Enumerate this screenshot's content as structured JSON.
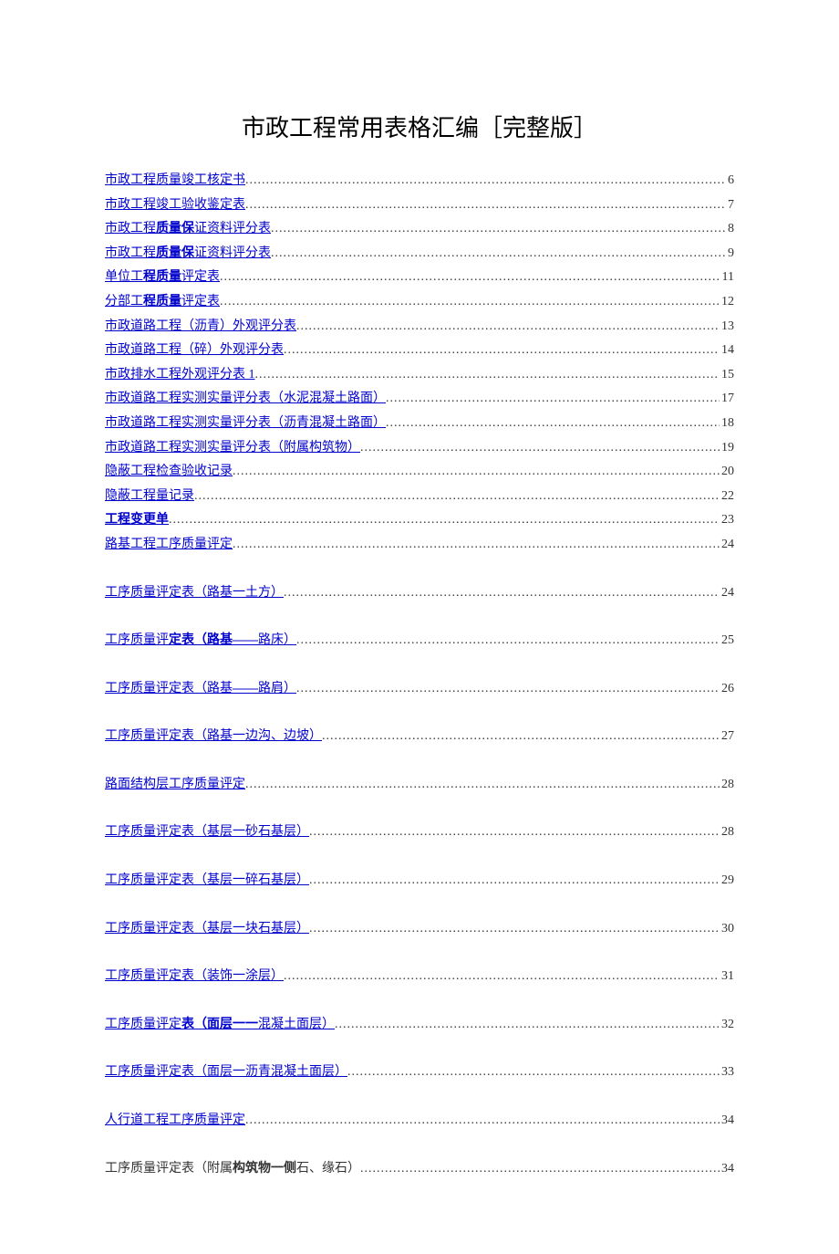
{
  "title": "市政工程常用表格汇编［完整版］",
  "toc": [
    {
      "label": "市政工程质量竣工核定书",
      "page": "6",
      "link": true,
      "spaced": false
    },
    {
      "label": "市政工程竣工验收鉴定表",
      "page": "7",
      "link": true,
      "spaced": false
    },
    {
      "label_prefix": "市政工程",
      "label_bold": "质量保",
      "label_suffix": "证资料评分表",
      "page": "8",
      "link": true,
      "spaced": false
    },
    {
      "label_prefix": "市政工程",
      "label_bold": "质量保",
      "label_suffix": "证资料评分表",
      "page": "9",
      "link": true,
      "spaced": false
    },
    {
      "label_prefix": "单位工",
      "label_bold": "程质量",
      "label_suffix": "评定表",
      "page": "11",
      "link": true,
      "spaced": false
    },
    {
      "label_prefix": "分部工",
      "label_bold": "程质量",
      "label_suffix": "评定表",
      "page": "12",
      "link": true,
      "spaced": false
    },
    {
      "label": "市政道路工程（沥青）外观评分表",
      "page": "13",
      "link": true,
      "spaced": false
    },
    {
      "label": "市政道路工程（碎）外观评分表",
      "page": "14",
      "link": true,
      "spaced": false
    },
    {
      "label": "市政排水工程外观评分表 1",
      "page": "15",
      "link": true,
      "spaced": false
    },
    {
      "label": "市政道路工程实测实量评分表（水泥混凝土路面）",
      "page": "17",
      "link": true,
      "spaced": false
    },
    {
      "label": "市政道路工程实测实量评分表（沥青混凝土路面）",
      "page": "18",
      "link": true,
      "spaced": false
    },
    {
      "label": "市政道路工程实测实量评分表（附属构筑物）",
      "page": "19",
      "link": true,
      "spaced": false
    },
    {
      "label": "隐蔽工程检查验收记录",
      "page": "20",
      "link": true,
      "spaced": false
    },
    {
      "label": "隐蔽工程量记录",
      "page": "22",
      "link": true,
      "spaced": false
    },
    {
      "label_bold": "工程变更单",
      "page": "23",
      "link": true,
      "spaced": false
    },
    {
      "label": "路基工程工序质量评定",
      "page": "24",
      "link": true,
      "spaced": false
    },
    {
      "label": "工序质量评定表（路基一土方）",
      "page": "24",
      "link": true,
      "spaced": true
    },
    {
      "label_prefix": "工序质量评",
      "label_bold": "定表（路基——",
      "label_suffix": "路床）",
      "page": "25",
      "link": true,
      "spaced": true
    },
    {
      "label_prefix": "工序质量评定表（路基",
      "label_bold": "——",
      "label_suffix": "路肩）",
      "page": "26",
      "link": true,
      "spaced": true
    },
    {
      "label": "工序质量评定表（路基一边沟、边坡）",
      "page": "27",
      "link": true,
      "spaced": true
    },
    {
      "label": "路面结构层工序质量评定",
      "page": "28",
      "link": true,
      "spaced": true
    },
    {
      "label": "工序质量评定表（基层一砂石基层）",
      "page": "28",
      "link": true,
      "spaced": true
    },
    {
      "label": "工序质量评定表（基层一碎石基层）",
      "page": "29",
      "link": true,
      "spaced": true
    },
    {
      "label": "工序质量评定表（基层一块石基层）",
      "page": "30",
      "link": true,
      "spaced": true
    },
    {
      "label": "工序质量评定表（装饰一涂层）",
      "page": "31",
      "link": true,
      "spaced": true
    },
    {
      "label_prefix": "工序质量评定",
      "label_bold": "表（面层一一",
      "label_suffix": "混凝土面层）",
      "page": "32",
      "link": true,
      "spaced": true
    },
    {
      "label": "工序质量评定表（面层一沥青混凝土面层）",
      "page": "33",
      "link": true,
      "spaced": true
    },
    {
      "label": "人行道工程工序质量评定",
      "page": "34",
      "link": true,
      "spaced": true
    },
    {
      "label_prefix": "工序质量评定表（附属",
      "label_bold": "构筑物一侧",
      "label_suffix": "石、缘石）",
      "page": "34",
      "link": false,
      "spaced": true
    }
  ]
}
